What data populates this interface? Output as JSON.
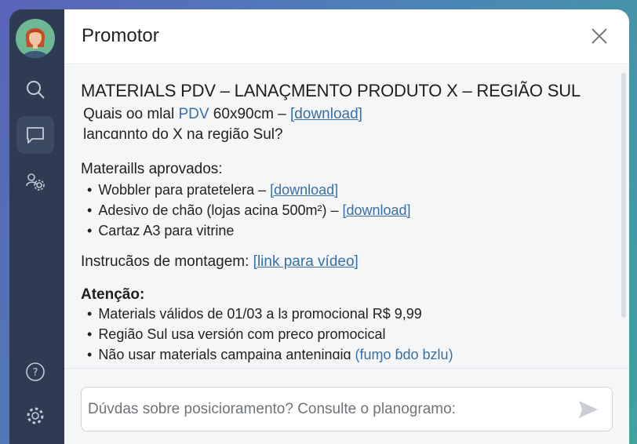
{
  "app": {
    "title": "Promotor"
  },
  "sidebar": {
    "icons": [
      "avatar",
      "search-icon",
      "chat-icon",
      "users-settings-icon",
      "help-icon",
      "gear-icon"
    ]
  },
  "message": {
    "heading": "MATERIALS PDV – LANAÇMENTO PRODUTO X – REGIÃO SUL",
    "question_part1": "Quais oo mlal ",
    "question_pdv": "PDV",
    "question_part2": " 60x90cm – ",
    "question_link": "[download]",
    "question_line2": "lancɑnnto do X na região Sul?",
    "approved_title": "Materaills aprovados:",
    "approved_items": [
      {
        "text": "Wobbler para pratetelera – ",
        "link": "[download]"
      },
      {
        "text": "Adesivo de chão (lojas acina 500m²) – ",
        "link": "[download]"
      },
      {
        "text": "Cartaz A3 para vitrine",
        "link": ""
      }
    ],
    "instructions_label": "Instrucãos de montagem: ",
    "instructions_link": "[link para vídeo]",
    "attention_title": "Atenção:",
    "attention_items": [
      {
        "text": "Materials válidos de 01/03 a lɜ promocional R$ 9,99",
        "blue": ""
      },
      {
        "text": "Região Sul usa versión com preco promocical",
        "blue": ""
      },
      {
        "text": "Não usar materials campaina anteninɑiɑ ",
        "blue": "(fuɱo ɓdo bzlu)"
      }
    ]
  },
  "chat": {
    "placeholder": "Dúvdas sobre posicioramento? Consulte o planogramo:"
  },
  "colors": {
    "sidebar": "#2e3b52",
    "accent_link": "#3a6ea8",
    "avatar_bg": "#6fb894"
  }
}
